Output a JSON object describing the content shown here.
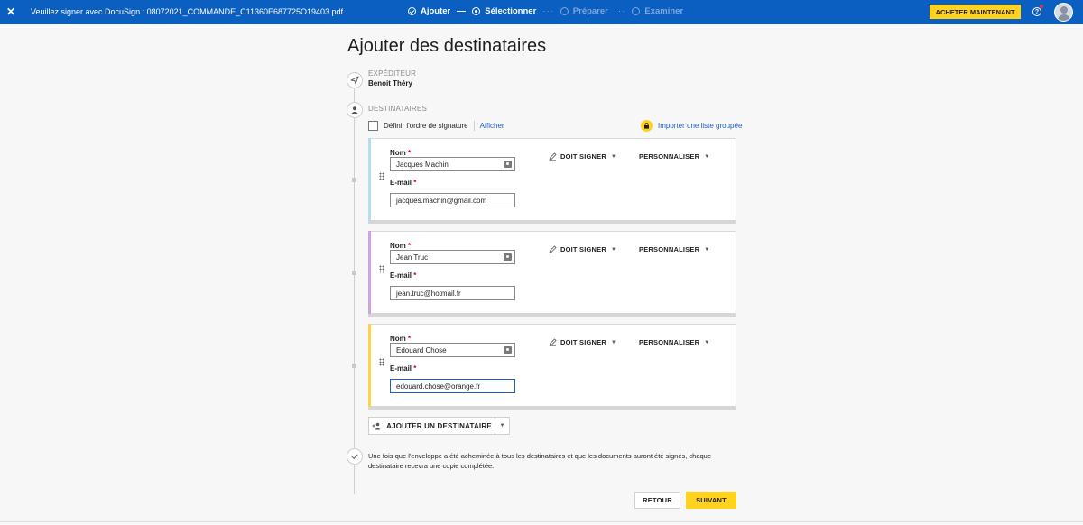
{
  "topbar": {
    "close_glyph": "✕",
    "document_title": "Veuillez signer avec DocuSign : 08072021_COMMANDE_C11360E687725O19403.pdf",
    "steps": [
      {
        "label": "Ajouter",
        "state": "done"
      },
      {
        "label": "Sélectionner",
        "state": "current"
      },
      {
        "label": "Préparer",
        "state": "future"
      },
      {
        "label": "Examiner",
        "state": "future"
      }
    ],
    "buy_label": "ACHETER MAINTENANT",
    "help_glyph": "?",
    "colors": {
      "bar": "#0a5fc0",
      "accent": "#ffd21e"
    }
  },
  "main": {
    "title": "Ajouter des destinataires",
    "sender": {
      "label": "EXPÉDITEUR",
      "name": "Benoit Théry"
    },
    "recipients_label": "DESTINATAIRES",
    "signing_order_label": "Définir l'ordre de signature",
    "show_link": "Afficher",
    "import_link": "Importer une liste groupée",
    "name_label": "Nom",
    "email_label": "E-mail",
    "required_mark": "*",
    "recipients": [
      {
        "name": "Jacques Machin",
        "email": "jacques.machin@gmail.com",
        "role": "DOIT SIGNER",
        "customize": "PERSONNALISER",
        "color": "#b7dcef"
      },
      {
        "name": "Jean Truc",
        "email": "jean.truc@hotmail.fr",
        "role": "DOIT SIGNER",
        "customize": "PERSONNALISER",
        "color": "#c9a7dd"
      },
      {
        "name": "Edouard Chose",
        "email": "edouard.chose@orange.fr",
        "role": "DOIT SIGNER",
        "customize": "PERSONNALISER",
        "color": "#ffd24a"
      }
    ],
    "add_recipient_label": "AJOUTER UN DESTINATAIRE",
    "final_note": "Une fois que l'enveloppe a été acheminée à tous les destinataires et que les documents auront été signés, chaque destinataire recevra une copie complétée.",
    "back_label": "RETOUR",
    "next_label": "SUIVANT"
  }
}
